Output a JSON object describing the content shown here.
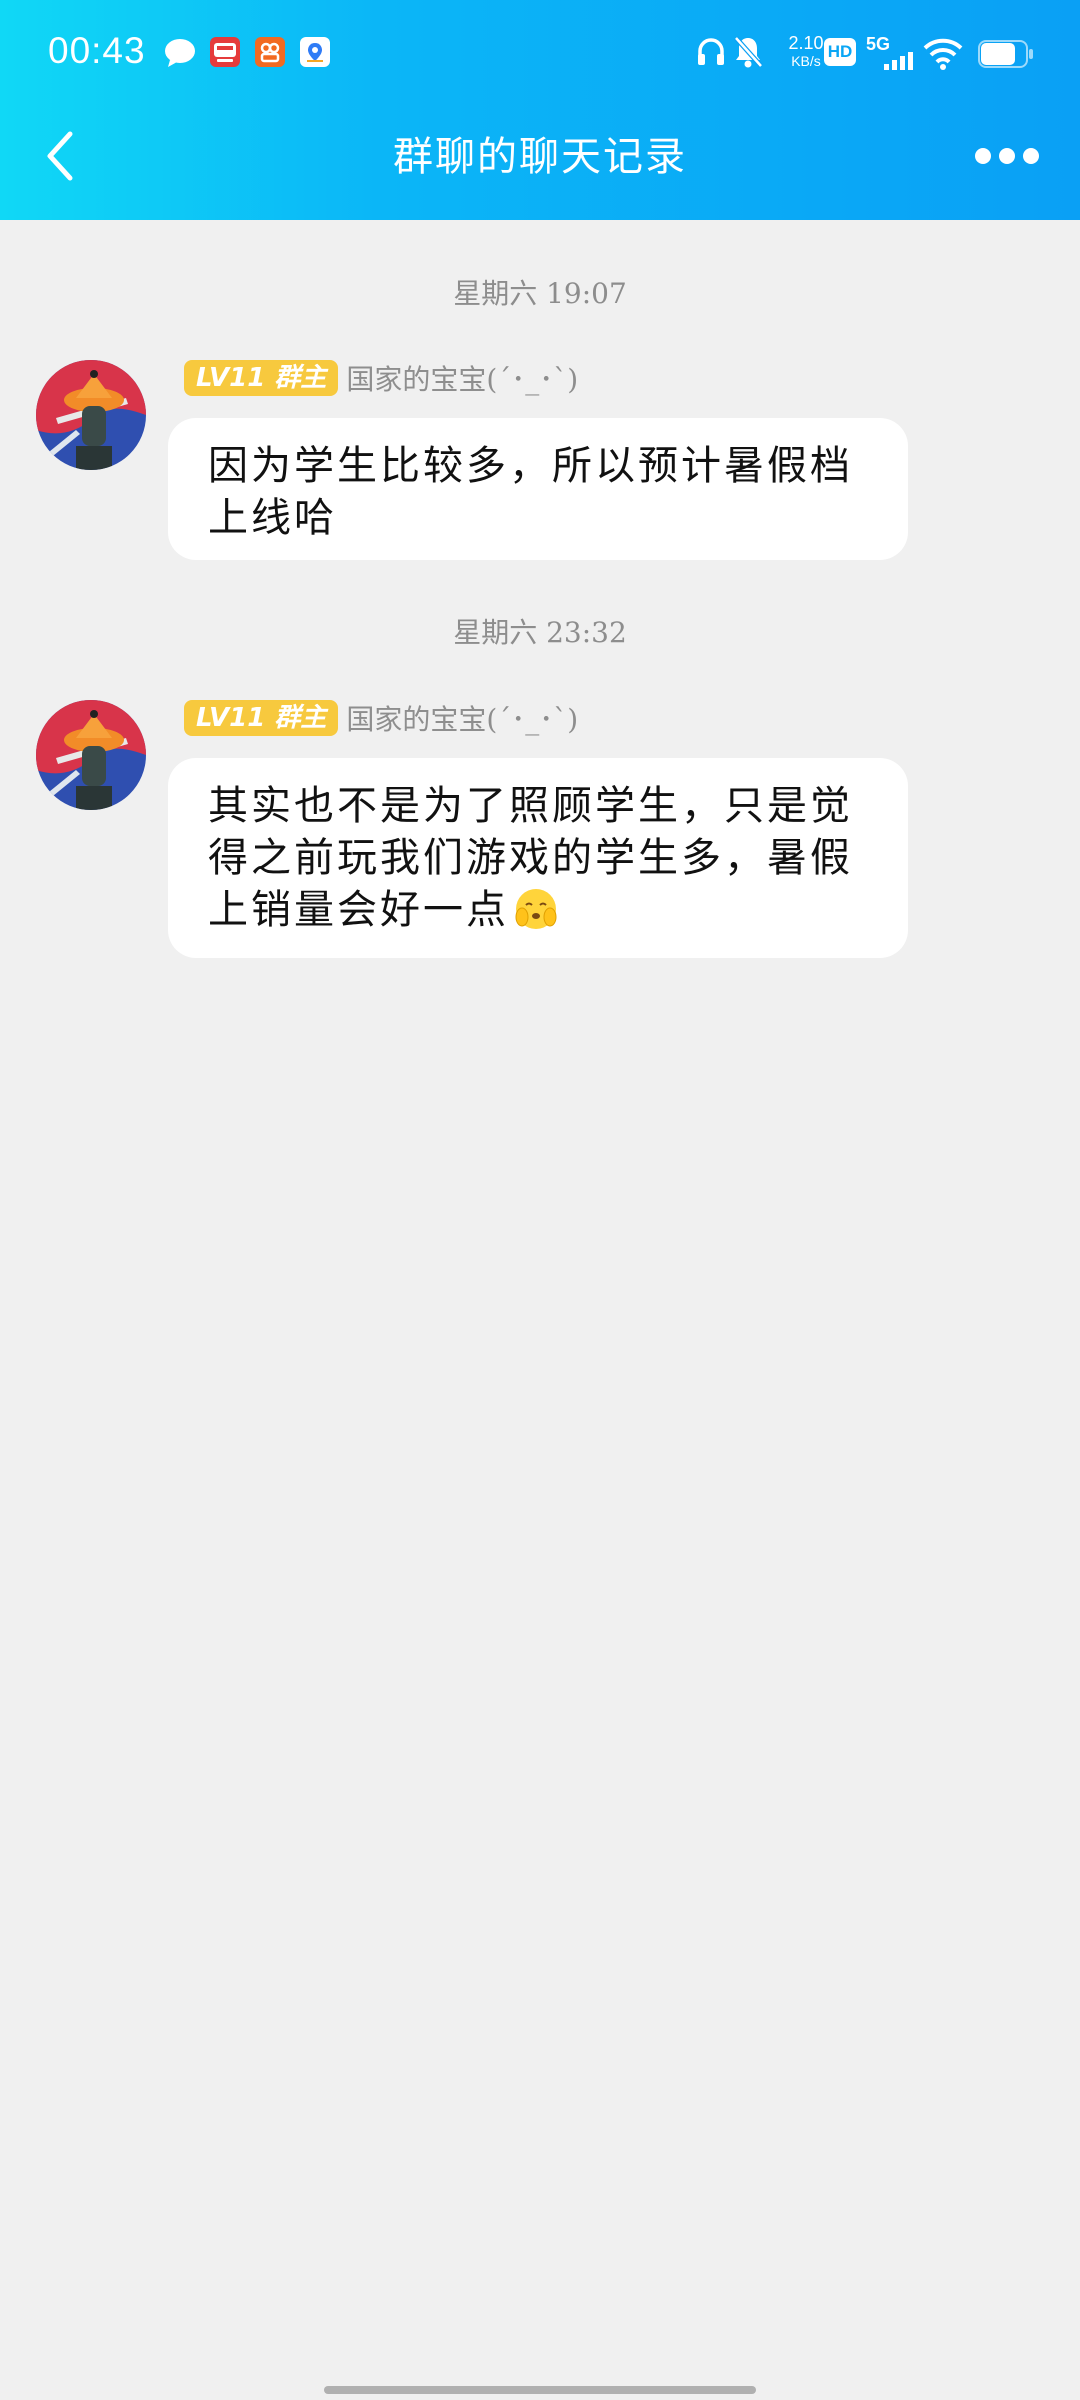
{
  "status_bar": {
    "time": "00:43",
    "net_speed_value": "2.10",
    "net_speed_unit": "KB/s",
    "hd_label": "HD",
    "network_label": "5G"
  },
  "header": {
    "title": "群聊的聊天记录"
  },
  "messages": [
    {
      "timestamp": "星期六 19:07",
      "badge": "LV11 群主",
      "sender": "国家的宝宝(´･_･`)",
      "text": "因为学生比较多，所以预计暑假档上线哈"
    },
    {
      "timestamp": "星期六 23:32",
      "badge": "LV11 群主",
      "sender": "国家的宝宝(´･_･`)",
      "text": "其实也不是为了照顾学生，只是觉得之前玩我们游戏的学生多，暑假上销量会好一点",
      "emoji": "blush-emoji"
    }
  ],
  "colors": {
    "header_gradient_start": "#10d8f6",
    "header_gradient_end": "#0aa0f5",
    "badge": "#f7c93e",
    "background": "#f0f0f0",
    "bubble": "#ffffff"
  }
}
